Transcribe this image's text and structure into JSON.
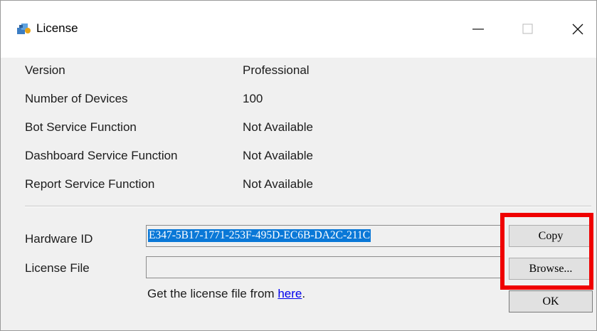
{
  "window": {
    "title": "License",
    "icon": "license-app-icon",
    "controls": [
      "minimize",
      "maximize",
      "close"
    ]
  },
  "info": [
    {
      "label": "Version",
      "value": "Professional"
    },
    {
      "label": "Number of Devices",
      "value": "100"
    },
    {
      "label": "Bot Service Function",
      "value": "Not Available"
    },
    {
      "label": "Dashboard Service Function",
      "value": "Not Available"
    },
    {
      "label": "Report Service Function",
      "value": "Not Available"
    }
  ],
  "hardware": {
    "label": "Hardware ID",
    "value": "E347-5B17-1771-253F-495D-EC6B-DA2C-211C"
  },
  "license_file": {
    "label": "License File",
    "value": ""
  },
  "buttons": {
    "copy": "Copy",
    "browse": "Browse...",
    "ok": "OK"
  },
  "hint": {
    "prefix": "Get the license file from ",
    "link": "here",
    "suffix": "."
  },
  "colors": {
    "highlight_box": "#ef0000",
    "selection": "#0a78d7",
    "link": "#0000ee"
  }
}
